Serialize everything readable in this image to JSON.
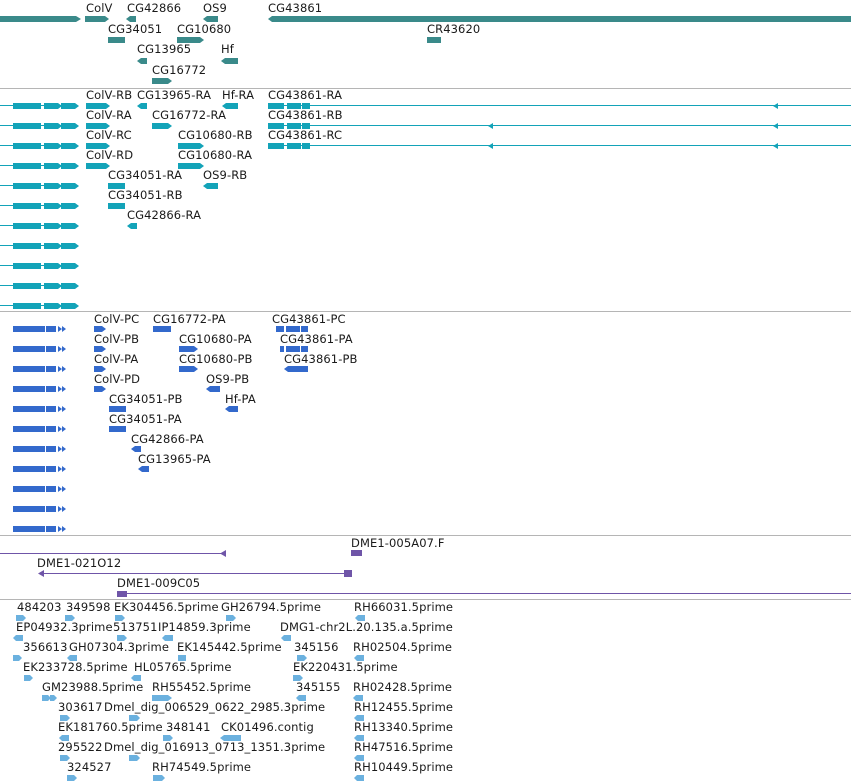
{
  "colors": {
    "gene": "#3a8a8a",
    "transcript": "#13a3b8",
    "protein": "#3369cc",
    "clone": "#6f55a8",
    "est": "#6bb1df",
    "separator": "#b5b5b5"
  },
  "tracks": {
    "genes": {
      "labels": [
        {
          "id": "g-colv",
          "text": "ColV"
        },
        {
          "id": "g-cg42866",
          "text": "CG42866"
        },
        {
          "id": "g-os9",
          "text": "OS9"
        },
        {
          "id": "g-cg43861",
          "text": "CG43861"
        },
        {
          "id": "g-cg34051",
          "text": "CG34051"
        },
        {
          "id": "g-cg10680",
          "text": "CG10680"
        },
        {
          "id": "g-cr43620",
          "text": "CR43620"
        },
        {
          "id": "g-cg13965",
          "text": "CG13965"
        },
        {
          "id": "g-hf",
          "text": "Hf"
        },
        {
          "id": "g-cg16772",
          "text": "CG16772"
        }
      ]
    },
    "transcripts": {
      "labels": [
        {
          "id": "t-colv-rb",
          "text": "ColV-RB"
        },
        {
          "id": "t-cg13965-ra",
          "text": "CG13965-RA"
        },
        {
          "id": "t-hf-ra",
          "text": "Hf-RA"
        },
        {
          "id": "t-cg43861-ra",
          "text": "CG43861-RA"
        },
        {
          "id": "t-colv-ra",
          "text": "ColV-RA"
        },
        {
          "id": "t-cg16772-ra",
          "text": "CG16772-RA"
        },
        {
          "id": "t-cg43861-rb",
          "text": "CG43861-RB"
        },
        {
          "id": "t-colv-rc",
          "text": "ColV-RC"
        },
        {
          "id": "t-cg10680-rb",
          "text": "CG10680-RB"
        },
        {
          "id": "t-cg43861-rc",
          "text": "CG43861-RC"
        },
        {
          "id": "t-colv-rd",
          "text": "ColV-RD"
        },
        {
          "id": "t-cg10680-ra",
          "text": "CG10680-RA"
        },
        {
          "id": "t-cg34051-ra",
          "text": "CG34051-RA"
        },
        {
          "id": "t-os9-rb",
          "text": "OS9-RB"
        },
        {
          "id": "t-cg34051-rb",
          "text": "CG34051-RB"
        },
        {
          "id": "t-cg42866-ra",
          "text": "CG42866-RA"
        }
      ]
    },
    "proteins": {
      "labels": [
        {
          "id": "p-colv-pc",
          "text": "ColV-PC"
        },
        {
          "id": "p-cg16772-pa",
          "text": "CG16772-PA"
        },
        {
          "id": "p-cg43861-pc",
          "text": "CG43861-PC"
        },
        {
          "id": "p-colv-pb",
          "text": "ColV-PB"
        },
        {
          "id": "p-cg10680-pa",
          "text": "CG10680-PA"
        },
        {
          "id": "p-cg43861-pa",
          "text": "CG43861-PA"
        },
        {
          "id": "p-colv-pa",
          "text": "ColV-PA"
        },
        {
          "id": "p-cg10680-pb",
          "text": "CG10680-PB"
        },
        {
          "id": "p-cg43861-pb",
          "text": "CG43861-PB"
        },
        {
          "id": "p-colv-pd",
          "text": "ColV-PD"
        },
        {
          "id": "p-os9-pb",
          "text": "OS9-PB"
        },
        {
          "id": "p-cg34051-pb",
          "text": "CG34051-PB"
        },
        {
          "id": "p-hf-pa",
          "text": "Hf-PA"
        },
        {
          "id": "p-cg34051-pa",
          "text": "CG34051-PA"
        },
        {
          "id": "p-cg42866-pa",
          "text": "CG42866-PA"
        },
        {
          "id": "p-cg13965-pa",
          "text": "CG13965-PA"
        }
      ]
    },
    "clones": {
      "labels": [
        {
          "id": "c-dme1-005a07",
          "text": "DME1-005A07.F"
        },
        {
          "id": "c-dme1-021o12",
          "text": "DME1-021O12"
        },
        {
          "id": "c-dme1-009c05",
          "text": "DME1-009C05"
        }
      ]
    },
    "ests": {
      "labels": [
        {
          "id": "e-484203",
          "text": "484203"
        },
        {
          "id": "e-349598",
          "text": "349598"
        },
        {
          "id": "e-ek304456",
          "text": "EK304456.5prime"
        },
        {
          "id": "e-gh26794",
          "text": "GH26794.5prime"
        },
        {
          "id": "e-rh66031",
          "text": "RH66031.5prime"
        },
        {
          "id": "e-ep04932",
          "text": "EP04932.3prime"
        },
        {
          "id": "e-513751",
          "text": "513751"
        },
        {
          "id": "e-ip14859",
          "text": "IP14859.3prime"
        },
        {
          "id": "e-dmg1",
          "text": "DMG1-chr2L.20.135.a.5prime"
        },
        {
          "id": "e-356613",
          "text": "356613"
        },
        {
          "id": "e-gh07304",
          "text": "GH07304.3prime"
        },
        {
          "id": "e-ek145442",
          "text": "EK145442.5prime"
        },
        {
          "id": "e-345156",
          "text": "345156"
        },
        {
          "id": "e-rh02504",
          "text": "RH02504.5prime"
        },
        {
          "id": "e-ek233728",
          "text": "EK233728.5prime"
        },
        {
          "id": "e-hl05765",
          "text": "HL05765.5prime"
        },
        {
          "id": "e-ek220431",
          "text": "EK220431.5prime"
        },
        {
          "id": "e-gm23988",
          "text": "GM23988.5prime"
        },
        {
          "id": "e-rh55452",
          "text": "RH55452.5prime"
        },
        {
          "id": "e-345155",
          "text": "345155"
        },
        {
          "id": "e-rh02428",
          "text": "RH02428.5prime"
        },
        {
          "id": "e-303617",
          "text": "303617"
        },
        {
          "id": "e-dmel-006529",
          "text": "Dmel_dig_006529_0622_2985.3prime"
        },
        {
          "id": "e-rh12455",
          "text": "RH12455.5prime"
        },
        {
          "id": "e-ek181760",
          "text": "EK181760.5prime"
        },
        {
          "id": "e-348141",
          "text": "348141"
        },
        {
          "id": "e-ck01496",
          "text": "CK01496.contig"
        },
        {
          "id": "e-rh13340",
          "text": "RH13340.5prime"
        },
        {
          "id": "e-295522",
          "text": "295522"
        },
        {
          "id": "e-dmel-016913",
          "text": "Dmel_dig_016913_0713_1351.3prime"
        },
        {
          "id": "e-rh47516",
          "text": "RH47516.5prime"
        },
        {
          "id": "e-324527",
          "text": "324527"
        },
        {
          "id": "e-rh74549",
          "text": "RH74549.5prime"
        },
        {
          "id": "e-rh10449",
          "text": "RH10449.5prime"
        }
      ]
    }
  }
}
